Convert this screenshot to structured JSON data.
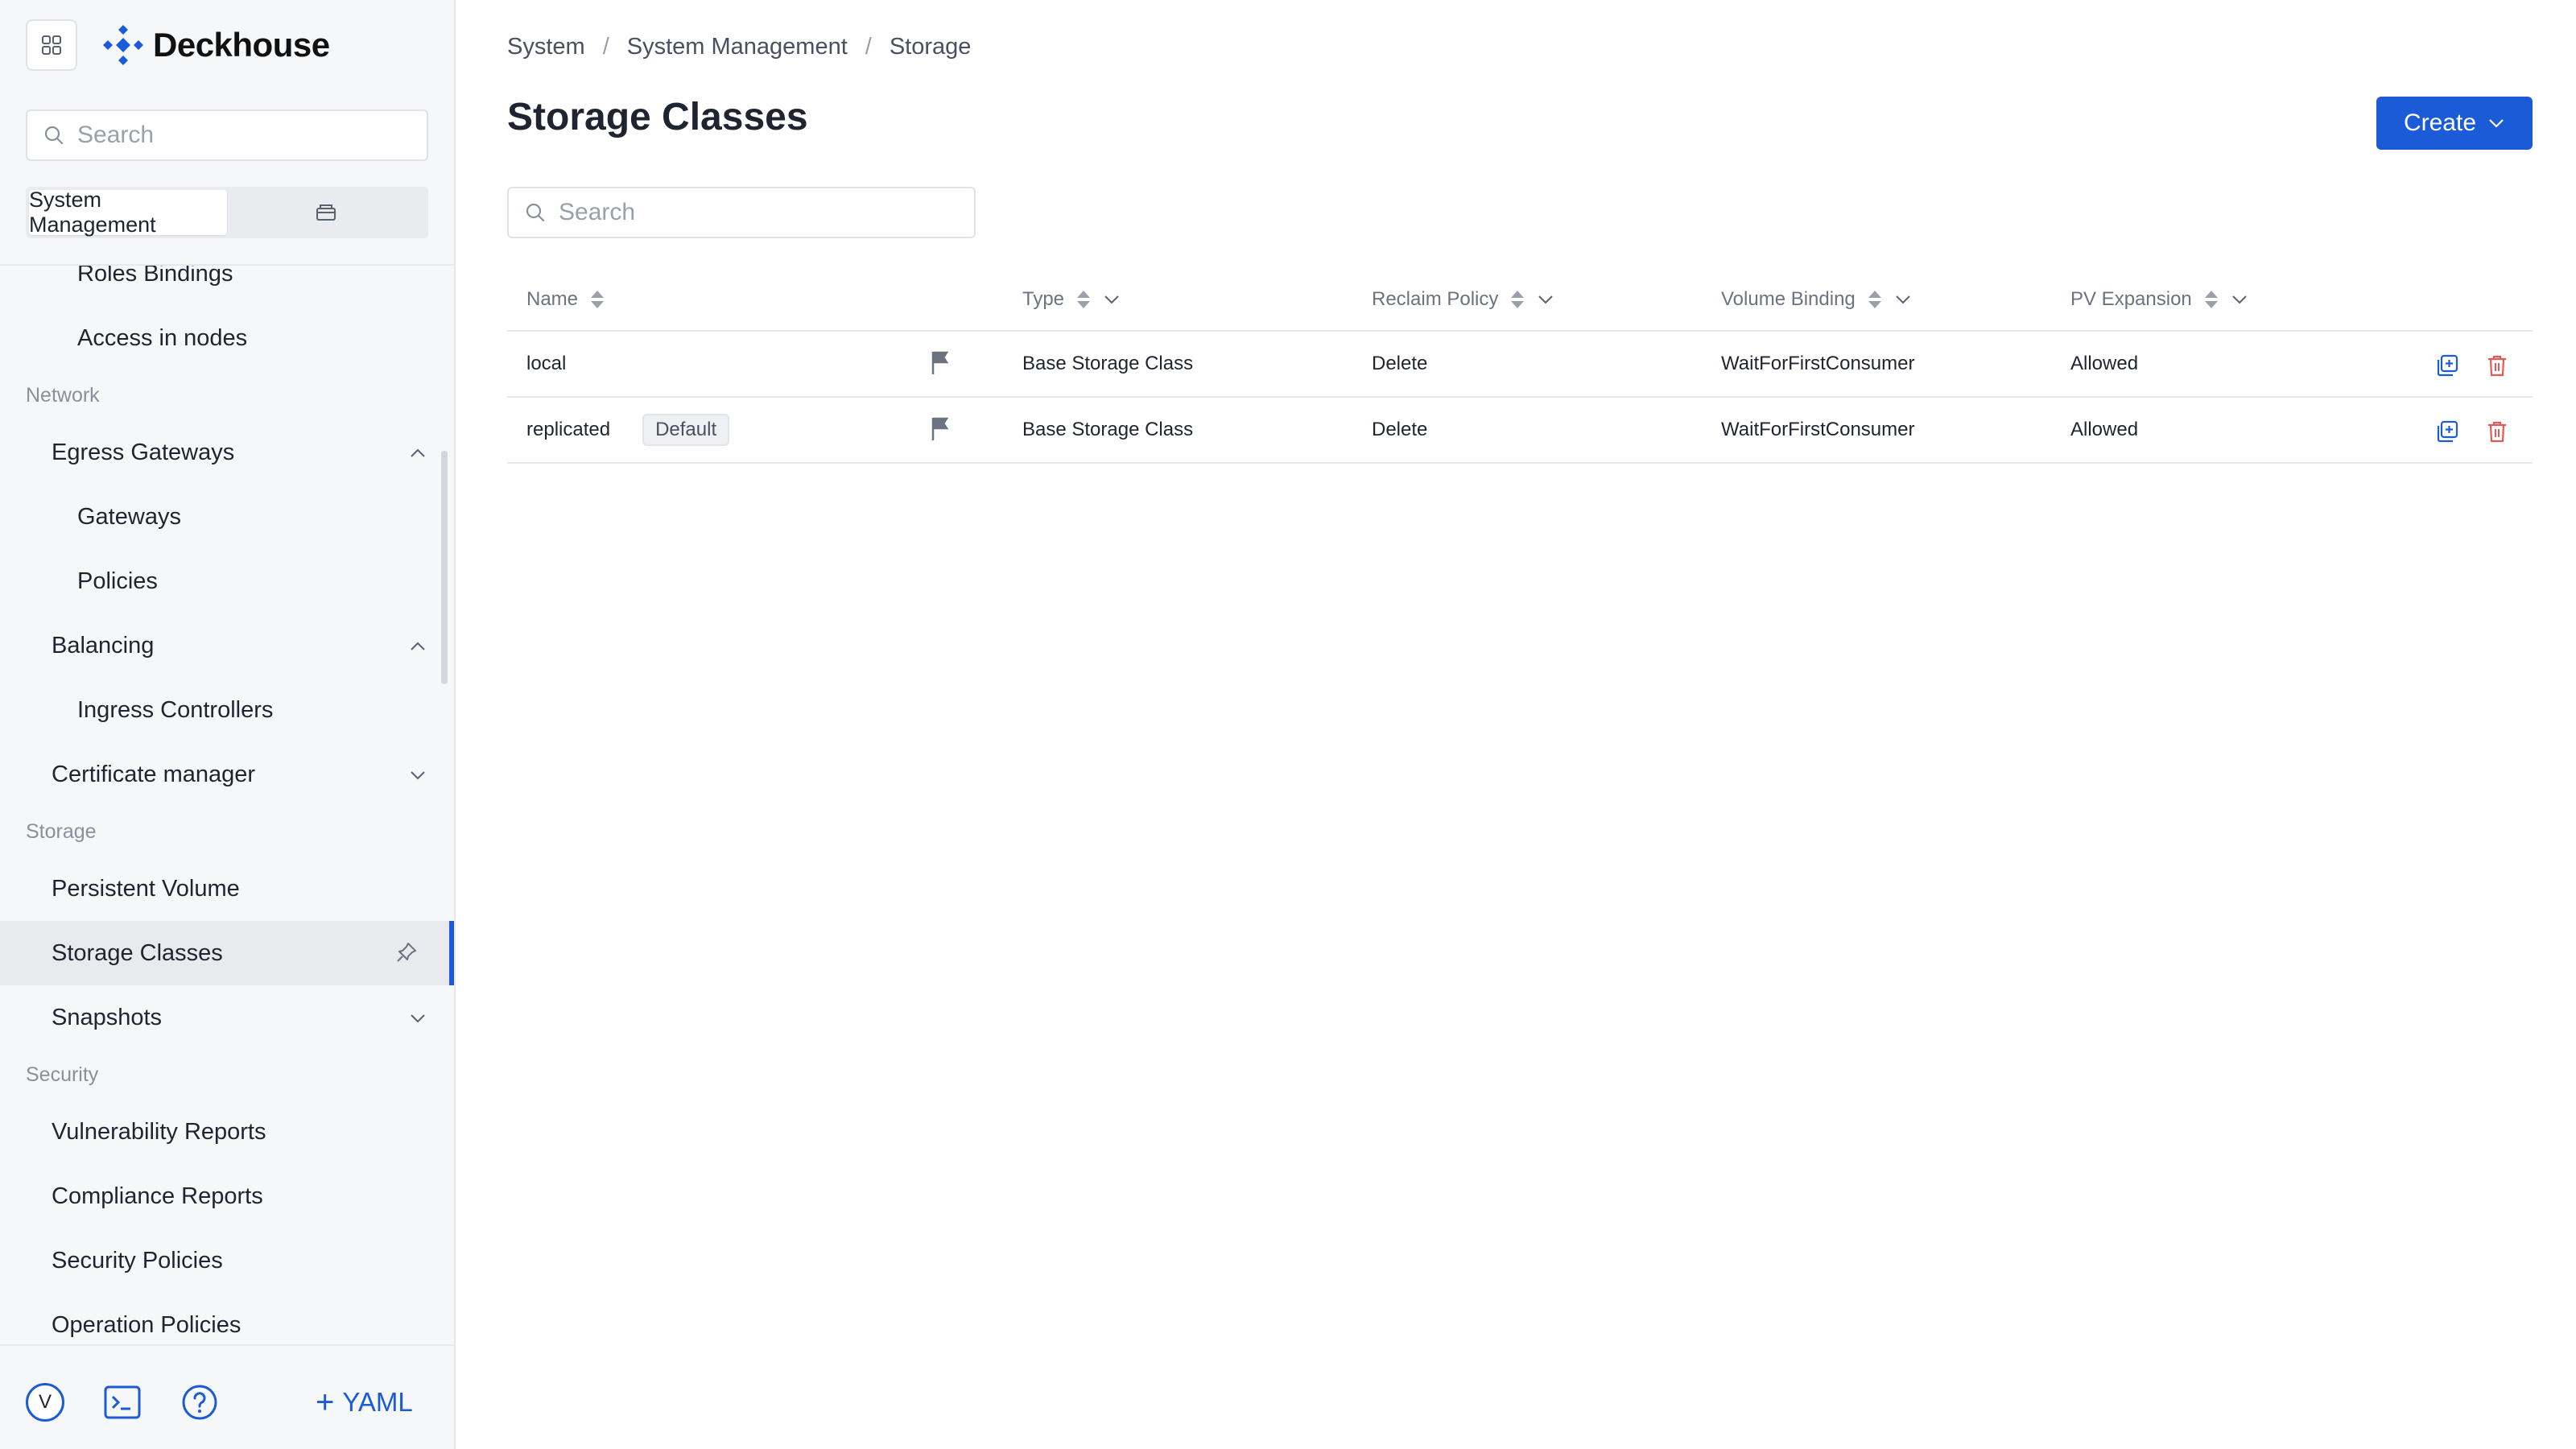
{
  "app": {
    "name": "Deckhouse"
  },
  "sidebar": {
    "search_placeholder": "Search",
    "segments": [
      "System Management"
    ],
    "nav": [
      {
        "kind": "item",
        "level": 2,
        "label": "Roles Bindings"
      },
      {
        "kind": "item",
        "level": 2,
        "label": "Access in nodes"
      },
      {
        "kind": "section",
        "label": "Network"
      },
      {
        "kind": "item",
        "level": 1,
        "label": "Egress Gateways",
        "chevron": "up"
      },
      {
        "kind": "item",
        "level": 2,
        "label": "Gateways"
      },
      {
        "kind": "item",
        "level": 2,
        "label": "Policies"
      },
      {
        "kind": "item",
        "level": 1,
        "label": "Balancing",
        "chevron": "up"
      },
      {
        "kind": "item",
        "level": 2,
        "label": "Ingress Controllers"
      },
      {
        "kind": "item",
        "level": 1,
        "label": "Certificate manager",
        "chevron": "down"
      },
      {
        "kind": "section",
        "label": "Storage"
      },
      {
        "kind": "item",
        "level": 1,
        "label": "Persistent Volume"
      },
      {
        "kind": "item",
        "level": 1,
        "label": "Storage Classes",
        "active": true,
        "pinned": true
      },
      {
        "kind": "item",
        "level": 1,
        "label": "Snapshots",
        "chevron": "down"
      },
      {
        "kind": "section",
        "label": "Security"
      },
      {
        "kind": "item",
        "level": 1,
        "label": "Vulnerability Reports"
      },
      {
        "kind": "item",
        "level": 1,
        "label": "Compliance Reports"
      },
      {
        "kind": "item",
        "level": 1,
        "label": "Security Policies"
      },
      {
        "kind": "item",
        "level": 1,
        "label": "Operation Policies"
      }
    ],
    "bottom": {
      "avatar_letter": "V",
      "yaml_label": "YAML"
    }
  },
  "breadcrumb": [
    "System",
    "System Management",
    "Storage"
  ],
  "page": {
    "title": "Storage Classes",
    "create_label": "Create",
    "search_placeholder": "Search"
  },
  "table": {
    "columns": [
      "Name",
      "Type",
      "Reclaim Policy",
      "Volume Binding",
      "PV Expansion"
    ],
    "rows": [
      {
        "name": "local",
        "badge": "",
        "type": "Base Storage Class",
        "reclaim": "Delete",
        "binding": "WaitForFirstConsumer",
        "expansion": "Allowed"
      },
      {
        "name": "replicated",
        "badge": "Default",
        "type": "Base Storage Class",
        "reclaim": "Delete",
        "binding": "WaitForFirstConsumer",
        "expansion": "Allowed"
      }
    ]
  },
  "colors": {
    "accent": "#1b5bd8",
    "danger": "#e05a5a",
    "sidebar_bg": "#f6f7f9"
  }
}
